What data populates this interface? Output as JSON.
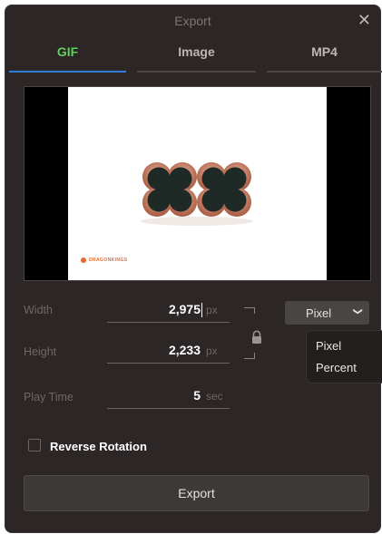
{
  "window": {
    "title": "Export"
  },
  "tabs": [
    {
      "label": "GIF",
      "active": true
    },
    {
      "label": "Image",
      "active": false
    },
    {
      "label": "MP4",
      "active": false
    }
  ],
  "preview": {
    "brand_text": "DRAGONKINGS"
  },
  "fields": {
    "width": {
      "label": "Width",
      "value": "2,975",
      "unit": "px"
    },
    "height": {
      "label": "Height",
      "value": "2,233",
      "unit": "px"
    },
    "play_time": {
      "label": "Play Time",
      "value": "5",
      "unit": "sec"
    }
  },
  "unit_select": {
    "selected": "Pixel",
    "options": [
      "Pixel",
      "Percent"
    ]
  },
  "reverse_rotation": {
    "label": "Reverse Rotation",
    "checked": false
  },
  "export_button": {
    "label": "Export"
  },
  "colors": {
    "active_tab": "#5fcf5f",
    "tab_underline": "#2f7ed8",
    "dialog_bg": "#2c2626",
    "brand": "#e8692a"
  }
}
